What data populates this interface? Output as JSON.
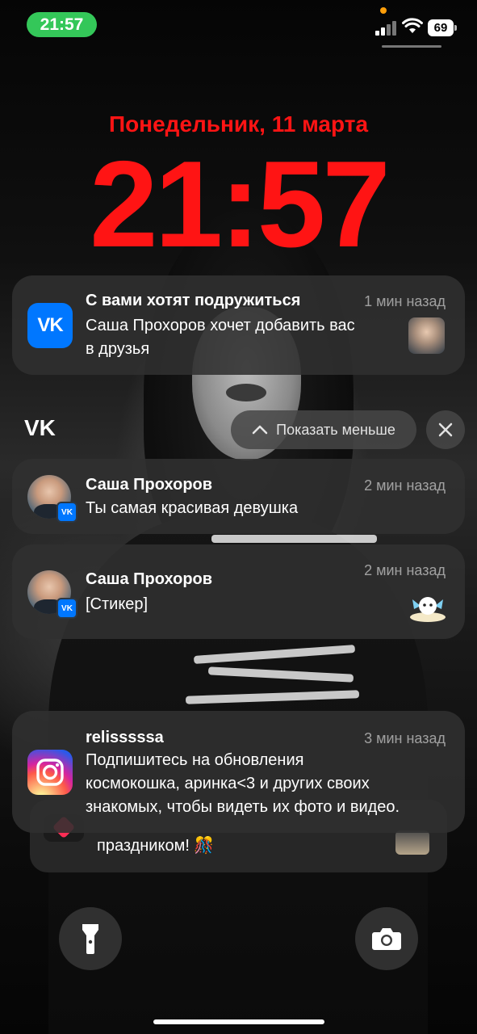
{
  "status_bar": {
    "time": "21:57",
    "battery": "69"
  },
  "lock_screen": {
    "date": "Понедельник, 11 марта",
    "time": "21:57"
  },
  "notifications": {
    "friend_request": {
      "app_icon": "vk-logo",
      "title": "С вами хотят подружиться",
      "time_ago": "1 мин назад",
      "body_line1": "Саша Прохоров хочет добавить вас",
      "body_line2": "в друзья"
    },
    "vk_group": {
      "label": "VK",
      "show_less": "Показать меньше",
      "items": [
        {
          "sender": "Саша Прохоров",
          "time_ago": "2 мин назад",
          "text": "Ты самая красивая девушка"
        },
        {
          "sender": "Саша Прохоров",
          "time_ago": "2 мин назад",
          "text": "[Стикер]"
        }
      ]
    },
    "instagram": {
      "app_icon": "instagram-logo",
      "title": "relisssssa",
      "time_ago": "3 мин назад",
      "body_line1": "Подпишитесь на обновления",
      "body_line2": "космокошка, аринка<3 и других своих",
      "body_line3": "знакомых, чтобы видеть их фото и видео."
    },
    "stacked_behind": {
      "text": "праздником! 🎊"
    }
  },
  "bottom_controls": {
    "left_icon": "flashlight-icon",
    "right_icon": "camera-icon"
  }
}
